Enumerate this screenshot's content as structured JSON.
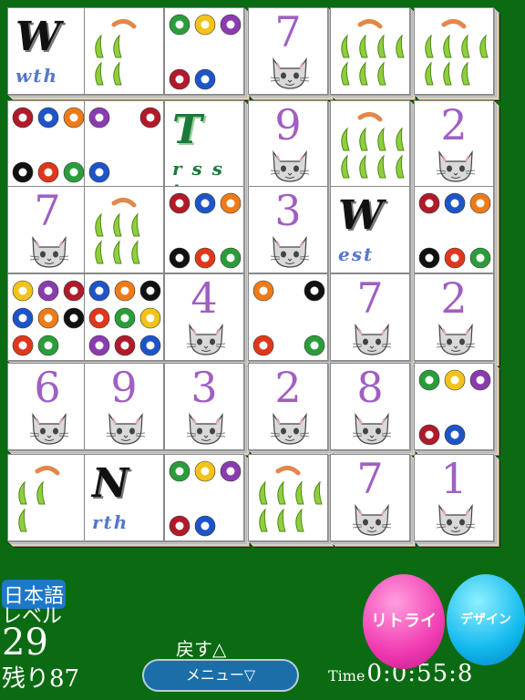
{
  "tiles": [
    {
      "kind": "wind",
      "glyph": "W",
      "word": "wth",
      "green": false
    },
    {
      "kind": "bamboo",
      "count": 4
    },
    {
      "kind": "balls",
      "count": 5
    },
    {
      "kind": "cat",
      "num": "7"
    },
    {
      "kind": "bamboo",
      "count": 7
    },
    {
      "kind": "bamboo",
      "count": 7
    },
    {
      "kind": "balls",
      "count": 6
    },
    {
      "kind": "balls",
      "count": 3
    },
    {
      "kind": "wind",
      "glyph": "T",
      "word": "r s s t",
      "green": true
    },
    {
      "kind": "cat",
      "num": "9"
    },
    {
      "kind": "bamboo",
      "count": 8
    },
    {
      "kind": "cat",
      "num": "2"
    },
    {
      "kind": "cat",
      "num": "7"
    },
    {
      "kind": "bamboo",
      "count": 6
    },
    {
      "kind": "balls",
      "count": 6
    },
    {
      "kind": "cat",
      "num": "3"
    },
    {
      "kind": "wind",
      "glyph": "W",
      "word": "est",
      "green": false
    },
    {
      "kind": "balls",
      "count": 6
    },
    {
      "kind": "balls",
      "count": 8
    },
    {
      "kind": "balls",
      "count": 9
    },
    {
      "kind": "cat",
      "num": "4"
    },
    {
      "kind": "balls",
      "count": 4
    },
    {
      "kind": "cat",
      "num": "7"
    },
    {
      "kind": "cat",
      "num": "2"
    },
    {
      "kind": "cat",
      "num": "6"
    },
    {
      "kind": "cat",
      "num": "9"
    },
    {
      "kind": "cat",
      "num": "3"
    },
    {
      "kind": "cat",
      "num": "2"
    },
    {
      "kind": "cat",
      "num": "8"
    },
    {
      "kind": "balls",
      "count": 5
    },
    {
      "kind": "bamboo",
      "count": 3
    },
    {
      "kind": "wind",
      "glyph": "N",
      "word": "rth",
      "green": false
    },
    {
      "kind": "balls",
      "count": 5
    },
    {
      "kind": "bamboo",
      "count": 7
    },
    {
      "kind": "cat",
      "num": "7"
    },
    {
      "kind": "cat",
      "num": "1"
    }
  ],
  "ui": {
    "language": "日本語",
    "level_label": "レベル",
    "level": "29",
    "remaining": "残り87",
    "undo": "戻す△",
    "menu": "メニュー▽",
    "time_label": "Time",
    "time": "0:0:55:8",
    "retry": "リトライ",
    "design": "デザイン"
  },
  "colors": {
    "felt": "#0b6b12",
    "number": "#a05fc2",
    "retry": "#f13bb3",
    "design": "#12b9ee"
  }
}
